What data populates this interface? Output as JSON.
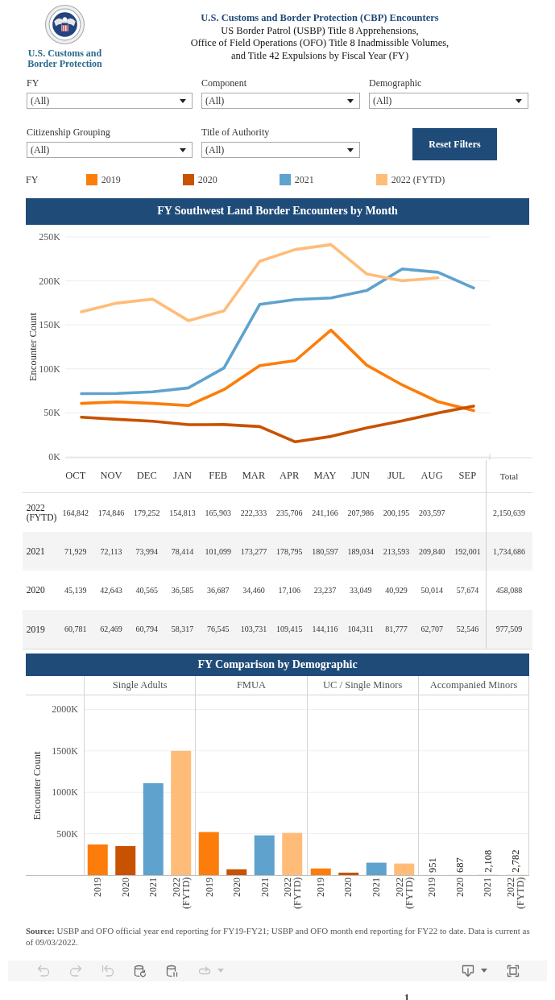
{
  "header": {
    "logo_text": "U.S. Customs and Border Protection",
    "title": "U.S. Customs and Border Protection (CBP) Encounters",
    "subtitle_lines": [
      "US Border Patrol (USBP) Title 8 Apprehensions,",
      "Office of Field Operations (OFO) Title 8 Inadmissible Volumes,",
      "and Title 42 Expulsions by Fiscal Year (FY)"
    ]
  },
  "filters": [
    {
      "label": "FY",
      "value": "(All)"
    },
    {
      "label": "Component",
      "value": "(All)"
    },
    {
      "label": "Demographic",
      "value": "(All)"
    },
    {
      "label": "Citizenship Grouping",
      "value": "(All)"
    },
    {
      "label": "Title of Authority",
      "value": "(All)"
    }
  ],
  "reset_button": {
    "label": "Reset Filters"
  },
  "legend": {
    "label": "FY"
  },
  "monthly_panel": {
    "title": "FY Southwest Land Border Encounters by Month",
    "chart_data": {
      "type": "line",
      "ylabel": "Encounter Count",
      "ylim": [
        0,
        250000
      ],
      "grid": true,
      "yticks": [
        {
          "value": 0,
          "label": "0K"
        },
        {
          "value": 50000,
          "label": "50K"
        },
        {
          "value": 100000,
          "label": "100K"
        },
        {
          "value": 150000,
          "label": "150K"
        },
        {
          "value": 200000,
          "label": "200K"
        },
        {
          "value": 250000,
          "label": "250K"
        }
      ],
      "series": [
        {
          "name": "2019",
          "color": "#fc7d0b",
          "values": [
            60781,
            62469,
            60794,
            58317,
            76545,
            103731,
            109415,
            144116,
            104311,
            81777,
            62707,
            52546
          ]
        },
        {
          "name": "2020",
          "color": "#c85200",
          "values": [
            45139,
            42643,
            40565,
            36585,
            36687,
            34460,
            17106,
            23237,
            33049,
            40929,
            50014,
            57674
          ]
        },
        {
          "name": "2021",
          "color": "#5fa2ce",
          "values": [
            71929,
            72113,
            73994,
            78414,
            101099,
            173277,
            178795,
            180597,
            189034,
            213593,
            209840,
            192001
          ]
        },
        {
          "name": "2022 (FYTD)",
          "color": "#ffbc79",
          "values": [
            164842,
            174846,
            179252,
            154813,
            165903,
            222333,
            235706,
            241166,
            207986,
            200195,
            203597,
            null
          ]
        }
      ]
    }
  },
  "monthly_table": {
    "columns": [
      "OCT",
      "NOV",
      "DEC",
      "JAN",
      "FEB",
      "MAR",
      "APR",
      "MAY",
      "JUN",
      "JUL",
      "AUG",
      "SEP",
      "Total"
    ],
    "rows": [
      {
        "label": "2022 (FYTD)",
        "cells": [
          "164,842",
          "174,846",
          "179,252",
          "154,813",
          "165,903",
          "222,333",
          "235,706",
          "241,166",
          "207,986",
          "200,195",
          "203,597",
          null,
          "2,150,639"
        ]
      },
      {
        "label": "2021",
        "cells": [
          "71,929",
          "72,113",
          "73,994",
          "78,414",
          "101,099",
          "173,277",
          "178,795",
          "180,597",
          "189,034",
          "213,593",
          "209,840",
          "192,001",
          "1,734,686"
        ]
      },
      {
        "label": "2020",
        "cells": [
          "45,139",
          "42,643",
          "40,565",
          "36,585",
          "36,687",
          "34,460",
          "17,106",
          "23,237",
          "33,049",
          "40,929",
          "50,014",
          "57,674",
          "458,088"
        ]
      },
      {
        "label": "2019",
        "cells": [
          "60,781",
          "62,469",
          "60,794",
          "58,317",
          "76,545",
          "103,731",
          "109,415",
          "144,116",
          "104,311",
          "81,777",
          "62,707",
          "52,546",
          "977,509"
        ]
      }
    ]
  },
  "demographic_panel": {
    "title": "FY Comparison by Demographic",
    "chart_data": {
      "type": "bar",
      "ylabel": "Encounter Count",
      "ylim": [
        0,
        2170000
      ],
      "grid": true,
      "categories": [
        "Single Adults",
        "FMUA",
        "UC / Single Minors",
        "Accompanied Minors"
      ],
      "yticks": [
        {
          "value": 500000,
          "label": "500K"
        },
        {
          "value": 1000000,
          "label": "1000K"
        },
        {
          "value": 1500000,
          "label": "1500K"
        },
        {
          "value": 2000000,
          "label": "2000K"
        }
      ],
      "series": [
        {
          "name": "2019",
          "color": "#fc7d0b",
          "values": [
            370000,
            520000,
            80000,
            951
          ],
          "value_labels": [
            null,
            null,
            null,
            "951"
          ]
        },
        {
          "name": "2020",
          "color": "#c85200",
          "values": [
            350000,
            70000,
            30000,
            687
          ],
          "value_labels": [
            null,
            null,
            null,
            "687"
          ]
        },
        {
          "name": "2021",
          "color": "#5fa2ce",
          "values": [
            1110000,
            480000,
            150000,
            2108
          ],
          "value_labels": [
            null,
            null,
            null,
            "2,108"
          ]
        },
        {
          "name": "2022 (FYTD)",
          "color": "#ffbc79",
          "values": [
            1500000,
            510000,
            140000,
            2782
          ],
          "value_labels": [
            null,
            null,
            null,
            "2,782"
          ]
        }
      ]
    }
  },
  "source_note": "**Source:** USBP and OFO official year end reporting for FY19-FY21; USBP and OFO month end reporting for FY22 to date. Data is current as of 09/03/2022.",
  "toolbar": {
    "left": [
      {
        "kind": "undo",
        "disabled": true
      },
      {
        "kind": "redo",
        "disabled": true
      },
      {
        "kind": "revert",
        "disabled": true
      },
      {
        "kind": "refresh",
        "disabled": false
      },
      {
        "kind": "pause",
        "disabled": false
      },
      {
        "kind": "share",
        "disabled": true
      }
    ],
    "right": [
      {
        "kind": "download",
        "disabled": false
      },
      {
        "kind": "fullscreen",
        "disabled": false
      }
    ]
  },
  "page_number": "1"
}
